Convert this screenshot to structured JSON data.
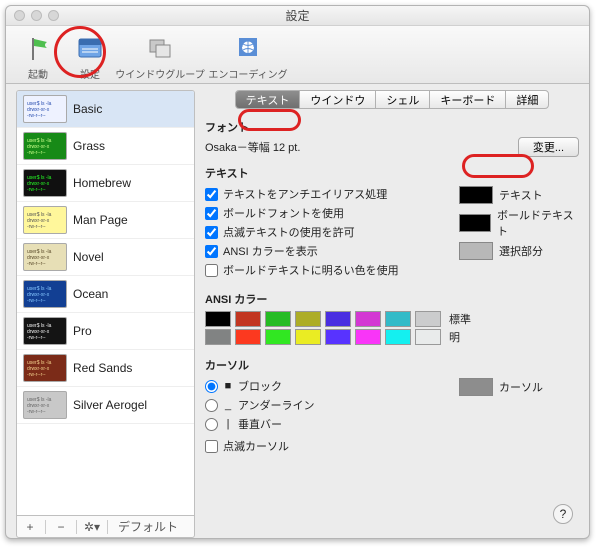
{
  "window": {
    "title": "設定"
  },
  "toolbar": {
    "items": [
      {
        "label": "起動"
      },
      {
        "label": "設定"
      },
      {
        "label": "ウインドウグループ"
      },
      {
        "label": "エンコーディング"
      }
    ]
  },
  "profiles": {
    "items": [
      {
        "name": "Basic",
        "bg": "#eef2ff",
        "fg": "#2a4fb0",
        "selected": true
      },
      {
        "name": "Grass",
        "bg": "#178a17",
        "fg": "#c8ff8a"
      },
      {
        "name": "Homebrew",
        "bg": "#101010",
        "fg": "#25ff25"
      },
      {
        "name": "Man Page",
        "bg": "#fff79b",
        "fg": "#555"
      },
      {
        "name": "Novel",
        "bg": "#e7dfb6",
        "fg": "#5a4a2a"
      },
      {
        "name": "Ocean",
        "bg": "#123f93",
        "fg": "#86c7ff"
      },
      {
        "name": "Pro",
        "bg": "#141414",
        "fg": "#f2f2f2"
      },
      {
        "name": "Red Sands",
        "bg": "#7b2b18",
        "fg": "#f2d08c"
      },
      {
        "name": "Silver Aerogel",
        "bg": "#c8c8c8",
        "fg": "#666"
      }
    ],
    "bar": {
      "default_label": "デフォルト"
    }
  },
  "tabs": {
    "items": [
      "テキスト",
      "ウインドウ",
      "シェル",
      "キーボード",
      "詳細"
    ],
    "active": 0
  },
  "font": {
    "section": "フォント",
    "current": "Osaka－等幅 12 pt.",
    "change_label": "変更..."
  },
  "text": {
    "section": "テキスト",
    "checks": [
      {
        "label": "テキストをアンチエイリアス処理",
        "checked": true
      },
      {
        "label": "ボールドフォントを使用",
        "checked": true
      },
      {
        "label": "点滅テキストの使用を許可",
        "checked": true
      },
      {
        "label": "ANSI カラーを表示",
        "checked": true
      },
      {
        "label": "ボールドテキストに明るい色を使用",
        "checked": false
      }
    ],
    "swatches": [
      {
        "label": "テキスト",
        "color": "#000000"
      },
      {
        "label": "ボールドテキスト",
        "color": "#000000"
      },
      {
        "label": "選択部分",
        "color": "#b8b8b8"
      }
    ]
  },
  "ansi": {
    "section": "ANSI カラー",
    "row1": {
      "label": "標準",
      "colors": [
        "#000000",
        "#c23621",
        "#25bc24",
        "#adad27",
        "#492ee1",
        "#d338d3",
        "#33bbc8",
        "#cbcccd"
      ]
    },
    "row2": {
      "label": "明",
      "colors": [
        "#818383",
        "#fc391f",
        "#31e722",
        "#eaec23",
        "#5833ff",
        "#f935f8",
        "#14f0f0",
        "#e9ebeb"
      ]
    }
  },
  "cursor": {
    "section": "カーソル",
    "options": [
      {
        "glyph": "■",
        "label": "ブロック",
        "selected": true
      },
      {
        "glyph": "_",
        "label": "アンダーライン",
        "selected": false
      },
      {
        "glyph": "|",
        "label": "垂直バー",
        "selected": false
      }
    ],
    "blink": {
      "label": "点滅カーソル",
      "checked": false
    },
    "swatch": {
      "label": "カーソル",
      "color": "#8d8d8d"
    }
  },
  "help": "?"
}
